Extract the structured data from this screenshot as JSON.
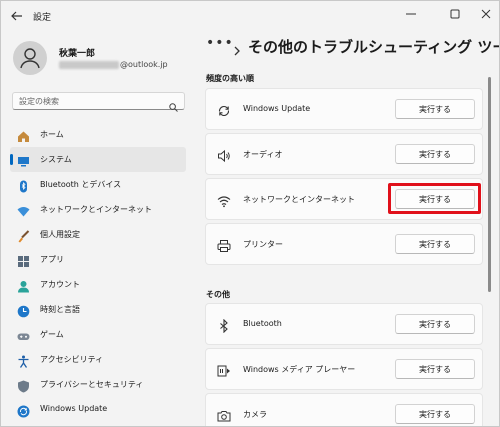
{
  "app": {
    "title": "設定"
  },
  "profile": {
    "name": "秋葉一郎",
    "email_suffix": "@outlook.jp"
  },
  "search": {
    "placeholder": "設定の検索"
  },
  "sidebar": {
    "items": [
      {
        "label": "ホーム",
        "icon": "home-icon"
      },
      {
        "label": "システム",
        "icon": "system-icon",
        "active": true
      },
      {
        "label": "Bluetooth とデバイス",
        "icon": "bluetooth-devices-icon"
      },
      {
        "label": "ネットワークとインターネット",
        "icon": "wifi-icon"
      },
      {
        "label": "個人用設定",
        "icon": "brush-icon"
      },
      {
        "label": "アプリ",
        "icon": "apps-icon"
      },
      {
        "label": "アカウント",
        "icon": "account-icon"
      },
      {
        "label": "時刻と言語",
        "icon": "time-language-icon"
      },
      {
        "label": "ゲーム",
        "icon": "gamepad-icon"
      },
      {
        "label": "アクセシビリティ",
        "icon": "accessibility-icon"
      },
      {
        "label": "プライバシーとセキュリティ",
        "icon": "shield-icon"
      },
      {
        "label": "Windows Update",
        "icon": "windows-update-icon"
      }
    ]
  },
  "header": {
    "breadcrumb_more": "•••",
    "title": "その他のトラブルシューティング ツール"
  },
  "sections": {
    "frequent": {
      "heading": "頻度の高い順",
      "items": [
        {
          "label": "Windows Update",
          "icon": "refresh-icon",
          "button": "実行する"
        },
        {
          "label": "オーディオ",
          "icon": "speaker-icon",
          "button": "実行する"
        },
        {
          "label": "ネットワークとインターネット",
          "icon": "wifi-icon",
          "button": "実行する",
          "highlighted": true
        },
        {
          "label": "プリンター",
          "icon": "printer-icon",
          "button": "実行する"
        }
      ]
    },
    "other": {
      "heading": "その他",
      "items": [
        {
          "label": "Bluetooth",
          "icon": "bluetooth-icon",
          "button": "実行する"
        },
        {
          "label": "Windows メディア プレーヤー",
          "icon": "media-player-icon",
          "button": "実行する"
        },
        {
          "label": "カメラ",
          "icon": "camera-icon",
          "button": "実行する"
        }
      ]
    }
  },
  "colors": {
    "accent": "#0067c0",
    "highlight": "#e0101a",
    "background": "#f3f3f3",
    "card": "#fbfbfb"
  }
}
